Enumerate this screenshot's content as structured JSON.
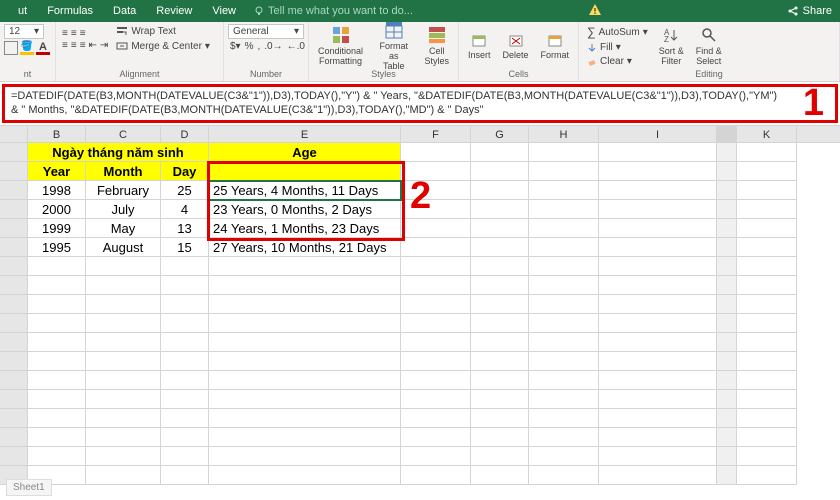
{
  "tabs": {
    "t0": "ut",
    "t1": "Formulas",
    "t2": "Data",
    "t3": "Review",
    "t4": "View",
    "tellme": "Tell me what you want to do...",
    "share": "Share"
  },
  "ribbon": {
    "font": {
      "size": "12",
      "groupLabel": "nt"
    },
    "align": {
      "wrap": "Wrap Text",
      "merge": "Merge & Center",
      "groupLabel": "Alignment"
    },
    "number": {
      "format": "General",
      "groupLabel": "Number"
    },
    "styles": {
      "cond": "Conditional\nFormatting",
      "table": "Format as\nTable",
      "cell": "Cell\nStyles",
      "groupLabel": "Styles"
    },
    "cells": {
      "insert": "Insert",
      "delete": "Delete",
      "format": "Format",
      "groupLabel": "Cells"
    },
    "editing": {
      "autosum": "AutoSum",
      "fill": "Fill",
      "clear": "Clear",
      "sort": "Sort &\nFilter",
      "find": "Find &\nSelect",
      "groupLabel": "Editing"
    }
  },
  "formula": {
    "line1": "=DATEDIF(DATE(B3,MONTH(DATEVALUE(C3&\"1\")),D3),TODAY(),\"Y\") & \" Years, \"&DATEDIF(DATE(B3,MONTH(DATEVALUE(C3&\"1\")),D3),TODAY(),\"YM\")",
    "line2": "& \" Months, \"&DATEDIF(DATE(B3,MONTH(DATEVALUE(C3&\"1\")),D3),TODAY(),\"MD\") & \" Days\""
  },
  "cols": {
    "B": "B",
    "C": "C",
    "D": "D",
    "E": "E",
    "F": "F",
    "G": "G",
    "H": "H",
    "I": "I",
    "K": "K"
  },
  "headers": {
    "dob": "Ngày tháng năm sinh",
    "age": "Age",
    "year": "Year",
    "month": "Month",
    "day": "Day"
  },
  "data": [
    {
      "year": "1998",
      "month": "February",
      "day": "25",
      "age": "25 Years, 4 Months, 11 Days"
    },
    {
      "year": "2000",
      "month": "July",
      "day": "4",
      "age": "23 Years, 0 Months, 2 Days"
    },
    {
      "year": "1999",
      "month": "May",
      "day": "13",
      "age": "24 Years, 1 Months, 23 Days"
    },
    {
      "year": "1995",
      "month": "August",
      "day": "15",
      "age": "27 Years, 10 Months, 21 Days"
    }
  ],
  "annotations": {
    "a1": "1",
    "a2": "2"
  },
  "widths": {
    "B": 58,
    "C": 75,
    "D": 48,
    "E": 192,
    "F": 70,
    "G": 58,
    "H": 70,
    "I": 118,
    "gap": 20,
    "K": 60
  }
}
